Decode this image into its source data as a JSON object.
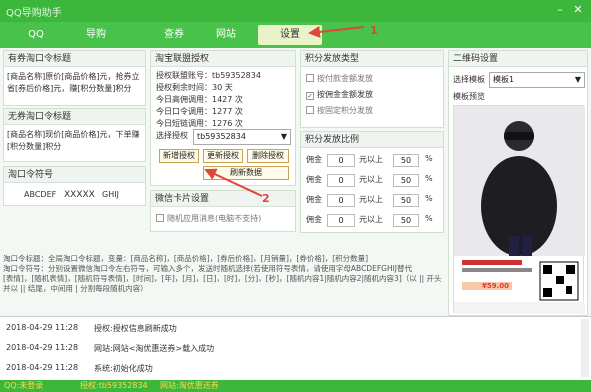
{
  "app": {
    "title": "QQ导购助手"
  },
  "tabs": [
    {
      "label": "QQ"
    },
    {
      "label": "导购"
    },
    {
      "label": "查券"
    },
    {
      "label": "网站"
    },
    {
      "label": "设置"
    }
  ],
  "coupon_title": {
    "header": "有券淘口令标题",
    "text": "[商品名称]原价[商品价格]元，抢券立省[券后价格]元，赚[积分数量]积分"
  },
  "no_coupon_title": {
    "header": "无券淘口令标题",
    "text": "[商品名称]现价[商品价格]元，下单赚[积分数量]积分"
  },
  "taokouling": {
    "header": "淘口令符号",
    "values": [
      "ABCDEF",
      "XXXXX",
      "GHIJ"
    ]
  },
  "auth": {
    "header": "淘宝联盟授权",
    "lines": [
      "授权联盟账号：tb59352834",
      "授权剩余时间：30 天",
      "今日高佣调用：1427 次",
      "今日口令调用：1277 次",
      "今日短链调用：1276 次"
    ],
    "select_label": "选择授权",
    "select_value": "tb59352834",
    "btn_new": "新增授权",
    "btn_update": "更新授权",
    "btn_delete": "删除授权",
    "btn_refresh": "刷新数据"
  },
  "wechat": {
    "header": "微信卡片设置",
    "checkbox": "随机应用消息(电脑不支持)"
  },
  "points_type": {
    "header": "积分发放类型",
    "options": [
      {
        "label": "按付款金额发放",
        "checked": false
      },
      {
        "label": "按佣金金额发放",
        "checked": true
      },
      {
        "label": "按固定积分发放",
        "checked": false
      }
    ]
  },
  "points_ratio": {
    "header": "积分发放比例",
    "rows": [
      {
        "a": "佣金",
        "b": "0",
        "c": "元以上",
        "d": "50",
        "e": "%"
      },
      {
        "a": "佣金",
        "b": "0",
        "c": "元以上",
        "d": "50",
        "e": "%"
      },
      {
        "a": "佣金",
        "b": "0",
        "c": "元以上",
        "d": "50",
        "e": "%"
      },
      {
        "a": "佣金",
        "b": "0",
        "c": "元以上",
        "d": "50",
        "e": "%"
      }
    ]
  },
  "qr": {
    "header": "二维码设置",
    "select_label": "选择模板",
    "select_value": "模板1",
    "preview_label": "模板预览",
    "price": "¥59.00"
  },
  "help_text": "淘口令标题：全局淘口令标题，变量：[商品名称]，[商品价格]，[券后价格]，[月销量]，[券价格]，[积分数量]\n淘口令符号：分别设置微信淘口令左右符号，可输入多个，发送时随机选择(若使用符号表情，请使用字母ABCDEFGHIJ替代\n[表情]，[随机表情]，[随机符号表情]，[时间]，[年]，[月]，[日]，[时]，[分]，[秒]，[随机内容1|随机内容2|随机内容3]（以 || 开头并以 || 结尾，中间用 | 分割每段随机内容）",
  "log": [
    {
      "date": "2018-04-29 11:28",
      "msg": "授权:授权信息刷新成功"
    },
    {
      "date": "2018-04-29 11:28",
      "msg": "网站:网站<淘优惠送券>载入成功"
    },
    {
      "date": "2018-04-29 11:28",
      "msg": "系统:初始化成功"
    }
  ],
  "status": {
    "login": "QQ:未登录",
    "account": "授权:tb59352834",
    "site": "网站:淘优惠送券"
  },
  "annotation_marks": [
    "1",
    "2"
  ],
  "colors": {
    "titlebar": "#3cb73c",
    "tabbar": "#48c24a",
    "arrow": "#e0443a"
  }
}
